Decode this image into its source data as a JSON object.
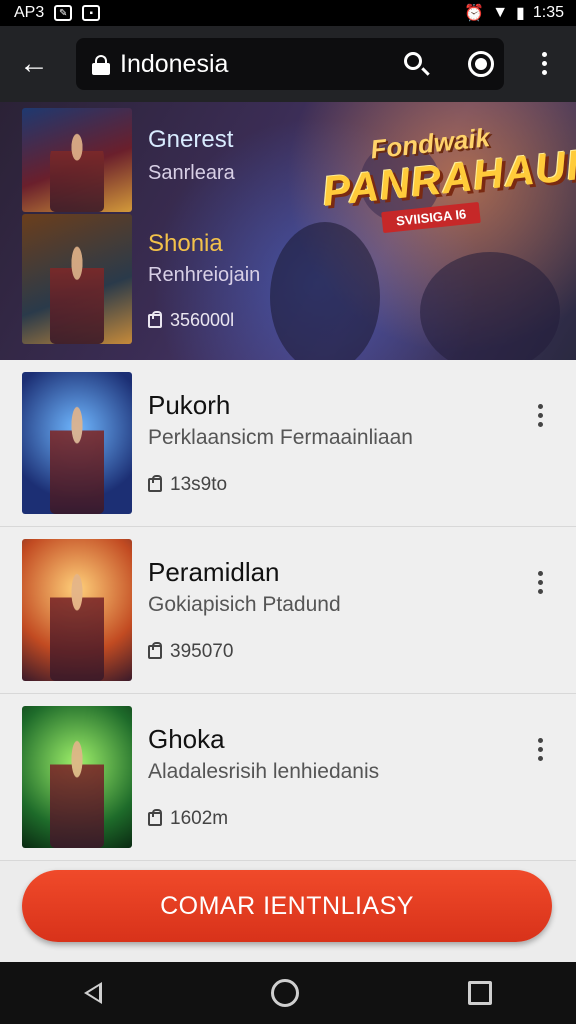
{
  "status_bar": {
    "left_text": "AP3",
    "time": "1:35"
  },
  "app_bar": {
    "search_text": "Indonesia"
  },
  "hero": {
    "item1_title": "Gnerest",
    "item1_sub": "Sanrleara",
    "item2_title": "Shonia",
    "item2_sub": "Renhreiojain",
    "count": "356000l",
    "banner_small": "Fondwaik",
    "banner_big": "PANRAHAUI!",
    "banner_tag": "SVIISIGA I6"
  },
  "list": [
    {
      "title": "Pukorh",
      "subtitle": "Perklaansicm Fermaainliaan",
      "count": "13s9to"
    },
    {
      "title": "Peramidlan",
      "subtitle": "Gokiapisich Ptadund",
      "count": "395070"
    },
    {
      "title": "Ghoka",
      "subtitle": "Aladalesrisih lenhiedanis",
      "count": "1602m"
    }
  ],
  "cta": {
    "label": "COMAR IENTNLIASY"
  },
  "colors": {
    "accent": "#e63b20",
    "app_bar": "#222326",
    "highlight": "#f3c24a"
  }
}
